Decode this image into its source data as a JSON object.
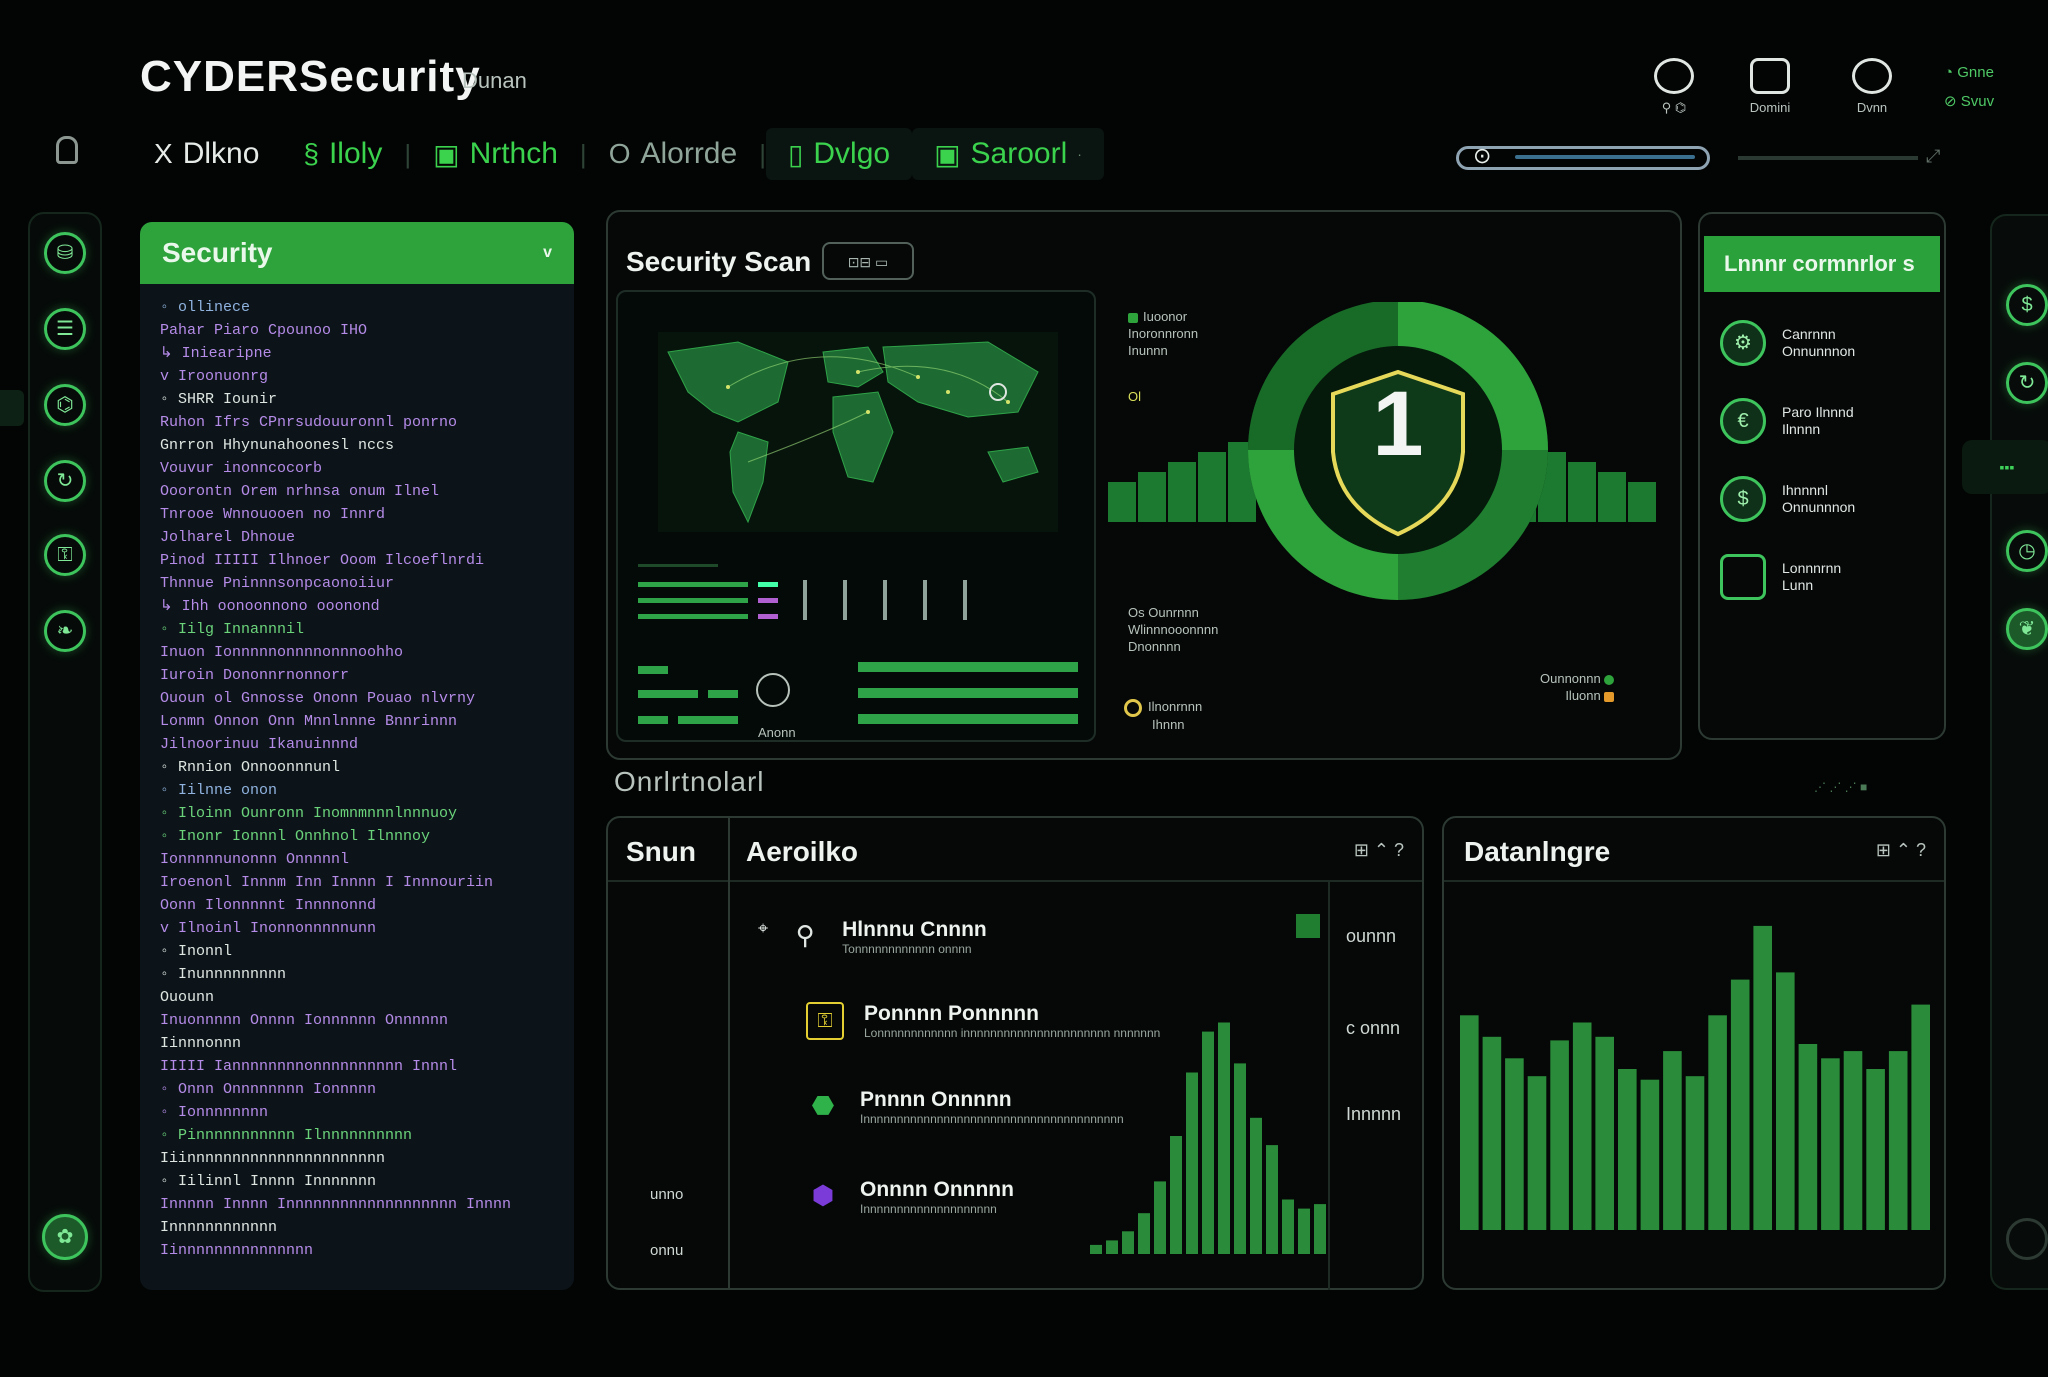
{
  "header": {
    "brand": "CYDERSecurity",
    "brand_sub": "Dunan",
    "icons": [
      {
        "name": "alerts-icon",
        "label": "",
        "sub": "⚲ ⌬"
      },
      {
        "name": "chat-icon",
        "label": "Domini"
      },
      {
        "name": "user-icon",
        "label": "Dvnn"
      }
    ],
    "status": [
      "Gnne",
      "Svuv"
    ]
  },
  "nav": {
    "items": [
      {
        "icon": "X",
        "label": "Dlkno",
        "color": "#e6ebe8"
      },
      {
        "icon": "§",
        "label": "Iloly",
        "color": "#3bd24e"
      },
      {
        "icon": "▣",
        "label": "Nrthch",
        "color": "#3bd24e"
      },
      {
        "icon": "O",
        "label": "Alorrde",
        "color": "#8fa59a"
      },
      {
        "icon": "▯",
        "label": "Dvlgo",
        "color": "#3bd24e"
      },
      {
        "icon": "▣",
        "label": "Saroorl",
        "color": "#3bd24e"
      }
    ],
    "search_indicator": "⊙"
  },
  "security_panel": {
    "title": "Security",
    "chevron": "v",
    "tree": [
      {
        "t": "◦ ollinece",
        "c": "c-blue"
      },
      {
        "t": "   Pahar Piaro Cpounoo IHO",
        "c": "c-purple"
      },
      {
        "t": "  ↳ Iniearipne",
        "c": "c-purple"
      },
      {
        "t": "v Iroonuonrg",
        "c": "c-purple"
      },
      {
        "t": "  ◦ SHRR Iounir",
        "c": "c-white"
      },
      {
        "t": "    Ruhon Ifrs CPnrsudouuronnl ponrno",
        "c": "c-purple"
      },
      {
        "t": "    Gnrron Hhynunahoonesl nccs",
        "c": "c-white"
      },
      {
        "t": "    Vouvur inonncocorb",
        "c": "c-purple"
      },
      {
        "t": "      Ooorontn Orem nrhnsa onum Ilnel",
        "c": "c-purple"
      },
      {
        "t": "      Tnrooe Wnnouooen no Innrd",
        "c": "c-purple"
      },
      {
        "t": "      Jolharel Dhnoue",
        "c": "c-purple"
      },
      {
        "t": "      Pinod IIIII Ilhnoer Ooom Ilcoeflnrdi",
        "c": "c-purple"
      },
      {
        "t": "      Thnnue Pninnnsonpcaonoiiur",
        "c": "c-purple"
      },
      {
        "t": "  ↳ Ihh oonoonnono ooonond",
        "c": "c-purple"
      },
      {
        "t": "  ◦ Iilg Innannnil",
        "c": "c-green"
      },
      {
        "t": "    Inuon Ionnnnnonnnnonnnoohho",
        "c": "c-purple"
      },
      {
        "t": "    Iuroin Dononnrnonnorr",
        "c": "c-purple"
      },
      {
        "t": "    Ououn ol Gnnosse Ononn Pouao nlvrny",
        "c": "c-purple"
      },
      {
        "t": "    Lonmn Onnon Onn Mnnlnnne Bnnrinnn",
        "c": "c-purple"
      },
      {
        "t": "    Jilnoorinuu Ikanuinnnd",
        "c": "c-purple"
      },
      {
        "t": "◦ Rnnion Onnoonnnunl",
        "c": "c-white"
      },
      {
        "t": "◦ Iilnne onon",
        "c": "c-blue"
      },
      {
        "t": "◦ Iloinn Ounronn Inomnmnnnlnnnuoy",
        "c": "c-green"
      },
      {
        "t": "  ◦ Inonr Ionnnl Onnhnol Ilnnnoy",
        "c": "c-green"
      },
      {
        "t": "    Ionnnnnunonnn Onnnnnl",
        "c": "c-purple"
      },
      {
        "t": "    Iroenonl Innnm Inn Innnn I Innnouriin",
        "c": "c-purple"
      },
      {
        "t": "    Oonn Ilonnnnnt Innnnonnd",
        "c": "c-purple"
      },
      {
        "t": "  v Ilnoinl Inonnonnnnnunn",
        "c": "c-purple"
      },
      {
        "t": "◦ Inonnl",
        "c": "c-white"
      },
      {
        "t": "  ◦ Inunnnnnnnnn",
        "c": "c-white"
      },
      {
        "t": "    Ouounn",
        "c": "c-white"
      },
      {
        "t": "    Inuonnnnn Onnnn Ionnnnnn Onnnnnn",
        "c": "c-purple"
      },
      {
        "t": "    Iinnnonnn",
        "c": "c-white"
      },
      {
        "t": "    IIIII Iannnnnnnnonnnnnnnnnn Innnl",
        "c": "c-purple"
      },
      {
        "t": "  ◦ Onnn Onnnnnnnn Ionnnnn",
        "c": "c-purple"
      },
      {
        "t": "◦ Ionnnnnnnn",
        "c": "c-purple"
      },
      {
        "t": "◦ Pinnnnnnnnnnn Ilnnnnnnnnnn",
        "c": "c-green"
      },
      {
        "t": "    Iiinnnnnnnnnnnnnnnnnnnnnn",
        "c": "c-white"
      },
      {
        "t": "  ◦ Iilinnl Innnn Innnnnnn",
        "c": "c-white"
      },
      {
        "t": "    Innnnn Innnn Innnnnnnnnnnnnnnnnnn Innnn",
        "c": "c-purple"
      },
      {
        "t": "    Innnnnnnnnnnn",
        "c": "c-white"
      },
      {
        "t": "  Iinnnnnnnnnnnnnnn",
        "c": "c-purple"
      }
    ]
  },
  "scan_panel": {
    "title": "Security Scan",
    "badge": "⊡⊟ ▭",
    "score": "1",
    "annotations": {
      "a1_line1": "Iuoonor",
      "a1_line2": "Inoronnronn",
      "a1_line3": "Inunnn",
      "a2": "Ol",
      "a3_line1": "Os Ounrnnn",
      "a3_line2": "Wlinnnooonnnn",
      "a3_line3": "Dnonnnn",
      "a4_line1": "Ilnonrnnn",
      "a4_line2": "Ihnnn",
      "a5_line1": "Ounnonnn",
      "a5_line2": "Iluonn"
    },
    "map_caption": "Anonn"
  },
  "connections_panel": {
    "title": "Lnnnr cormnrlor s",
    "items": [
      {
        "icon": "⚙",
        "line1": "Canrnnn",
        "line2": "Onnunnnon"
      },
      {
        "icon": "€",
        "line1": "Paro Ilnnnd",
        "line2": "Ilnnnn"
      },
      {
        "icon": "$",
        "line1": "Ihnnnnl",
        "line2": "Onnunnnon"
      },
      {
        "icon": "",
        "line1": "Lonnnrnn",
        "line2": "Lunn"
      }
    ]
  },
  "overview": {
    "title": "Onrlrtnolarl",
    "indicators": "⋰ ⋰ ⋰ ■"
  },
  "activity_panel": {
    "col1_title": "Snun",
    "col2_title": "Aeroilko",
    "controls": "⊞ ⌃ ?",
    "left_values": [
      "unno",
      "onnu"
    ],
    "items": [
      {
        "icon": "⚲",
        "name": "Hlnnnu Cnnnn",
        "desc": "Tonnnnnnnnnnnn onnnn",
        "value": "ounnn",
        "color": "#e0e6e2"
      },
      {
        "icon": "⚿",
        "name": "Ponnnn Ponnnnn",
        "desc": "Lonnnnnnnnnnnn  innnnnnnnnnnnnnnnnnnnnn nnnnnnn",
        "value": "c onnn",
        "color": "#e3cf32"
      },
      {
        "icon": "⬣",
        "name": "Pnnnn Onnnnn",
        "desc": "Innnnnnnnnnnnnnnnnnnnnnnnnnnnnnnnnnnnnnn",
        "value": "Innnnn",
        "color": "#2fb24a"
      },
      {
        "icon": "⬢",
        "name": "Onnnn Onnnnn",
        "desc": "Innnnnnnnnnnnnnnnnnnn",
        "value": "",
        "color": "#7a3bd8"
      }
    ]
  },
  "datamap_panel": {
    "title": "Datanlngre",
    "controls": "⊞ ⌃ ?"
  },
  "chart_data": [
    {
      "type": "bar",
      "name": "activity-bars",
      "values": [
        2,
        3,
        5,
        9,
        16,
        26,
        40,
        49,
        51,
        42,
        30,
        24,
        12,
        10,
        11
      ]
    },
    {
      "type": "bar",
      "name": "datamap-bars",
      "values": [
        60,
        54,
        48,
        43,
        53,
        58,
        54,
        45,
        42,
        50,
        43,
        60,
        70,
        85,
        72,
        52,
        48,
        50,
        45,
        50,
        63
      ]
    }
  ],
  "colors": {
    "accent": "#2ea33c",
    "accent_bright": "#3fd25a",
    "shield_ring": "#e6d95a",
    "background": "#030504"
  }
}
